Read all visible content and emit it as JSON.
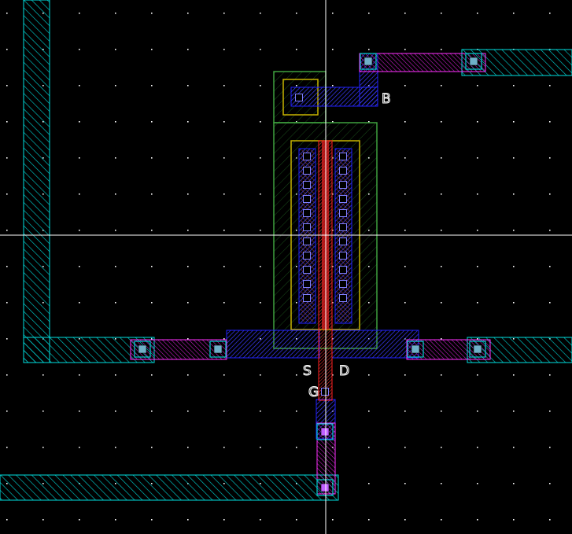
{
  "title": "",
  "colors": {
    "background": "#000000",
    "grid_dot": "#ffffff",
    "metal2": "#00ffff",
    "metal1": "#0000ff",
    "poly": "#ff0000",
    "via": "#ff00ff",
    "contact": "#00d0d0",
    "nwell": "#228b22",
    "diffusion": "#ffd700",
    "diffusion_fill": "#8b4000",
    "crosshair": "#ffffff"
  },
  "pins": {
    "bulk": "B",
    "source": "S",
    "drain": "D",
    "gate": "G"
  },
  "layers": [
    "metal2",
    "metal1",
    "poly",
    "via",
    "contact",
    "nwell",
    "diffusion"
  ]
}
